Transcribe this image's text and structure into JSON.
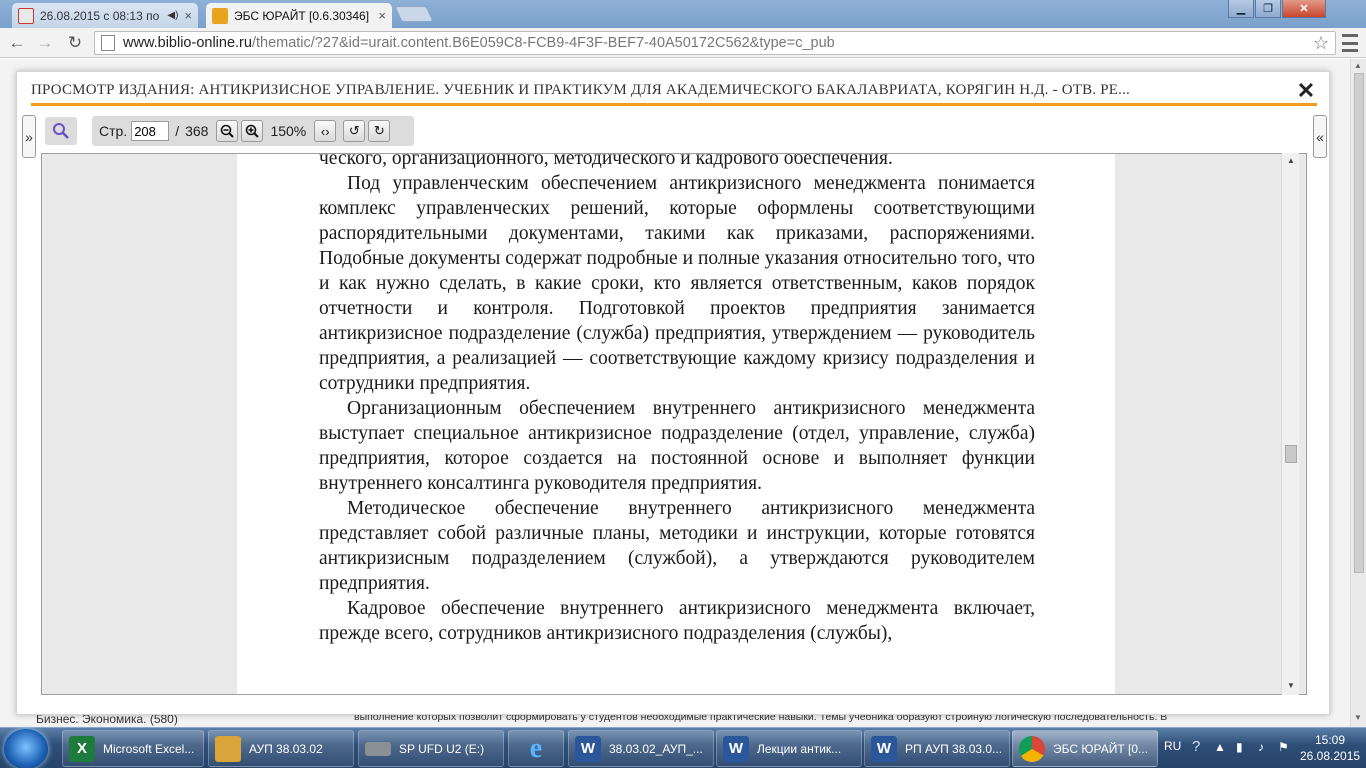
{
  "browser": {
    "tabs": [
      {
        "title": "26.08.2015 с 08:13 по (",
        "icon": "mail-favicon",
        "active": false
      },
      {
        "title": "ЭБС ЮРАЙТ [0.6.30346]",
        "icon": "urait-favicon",
        "active": true
      }
    ],
    "url_domain": "www.biblio-online.ru",
    "url_path": "/thematic/?27&id=urait.content.B6E059C8-FCB9-4F3F-BEF7-40A50172C562&type=c_pub"
  },
  "background_page": {
    "left_text": "Бизнес. Экономика. (580)",
    "right_text": "выполнение которых позволит сформировать у студентов необходимые практические навыки. Темы учебника образуют стройную логическую последовательность. В"
  },
  "viewer": {
    "title": "ПРОСМОТР ИЗДАНИЯ: АНТИКРИЗИСНОЕ УПРАВЛЕНИЕ. УЧЕБНИК И ПРАКТИКУМ ДЛЯ АКАДЕМИЧЕСКОГО БАКАЛАВРИАТА, КОРЯГИН Н.Д. - ОТВ. РЕ...",
    "close_label": "✕",
    "page_label": "Стр.",
    "page_current": "208",
    "page_separator": "/",
    "page_total": "368",
    "zoom": "150%",
    "collapse_left": "»",
    "collapse_right": "«"
  },
  "document": {
    "paragraphs": [
      "ческого, организационного, методического и кадрового обеспечения.",
      "Под управленческим обеспечением антикризисного менеджмента понимается комплекс управленческих решений, которые оформлены соответствующими распорядительными документами, такими как приказами, распоряжениями. Подобные документы содержат подробные и полные указания относительно того, что и как нужно сделать, в какие сроки, кто является ответственным, каков порядок отчетности и контроля. Подготовкой проектов предприятия занимается антикризисное подразделение (служба) предприятия, утверждением — руководитель предприятия, а реализацией — соответствующие каждому кризису подразделения и сотрудники предприятия.",
      "Организационным обеспечением внутреннего антикризисного менеджмента выступает специальное антикризисное подразделение (отдел, управление, служба) предприятия, которое создается на постоянной основе и выполняет функции внутреннего консалтинга руководителя предприятия.",
      "Методическое обеспечение внутреннего антикризисного менеджмента представляет собой различные планы, методики и инструкции, которые готовятся антикризисным подразделением (службой), а утверждаются руководителем предприятия.",
      "Кадровое обеспечение внутреннего антикризисного менеджмента включает, прежде всего, сотрудников антикризисного подразделения (службы),"
    ]
  },
  "taskbar": {
    "items": [
      {
        "label": "Microsoft Excel...",
        "icon": "excel-icon",
        "color": "#1f7a3d",
        "glyph": "X"
      },
      {
        "label": "АУП 38.03.02",
        "icon": "folder-icon",
        "color": "#d9a53a",
        "glyph": ""
      },
      {
        "label": "SP UFD U2 (E:)",
        "icon": "usb-drive-icon",
        "color": "#8a8f96",
        "glyph": ""
      },
      {
        "label": "",
        "icon": "internet-explorer-icon",
        "color": "#1e88e5",
        "glyph": "e"
      },
      {
        "label": "38.03.02_АУП_...",
        "icon": "word-icon",
        "color": "#2b579a",
        "glyph": "W"
      },
      {
        "label": "Лекции антик...",
        "icon": "word-icon",
        "color": "#2b579a",
        "glyph": "W"
      },
      {
        "label": "РП АУП 38.03.0...",
        "icon": "word-icon",
        "color": "#2b579a",
        "glyph": "W"
      },
      {
        "label": "ЭБС ЮРАЙТ [0...",
        "icon": "chrome-icon",
        "color": "#db4437",
        "glyph": "◉"
      }
    ],
    "language": "RU",
    "time": "15:09",
    "date": "26.08.2015"
  }
}
